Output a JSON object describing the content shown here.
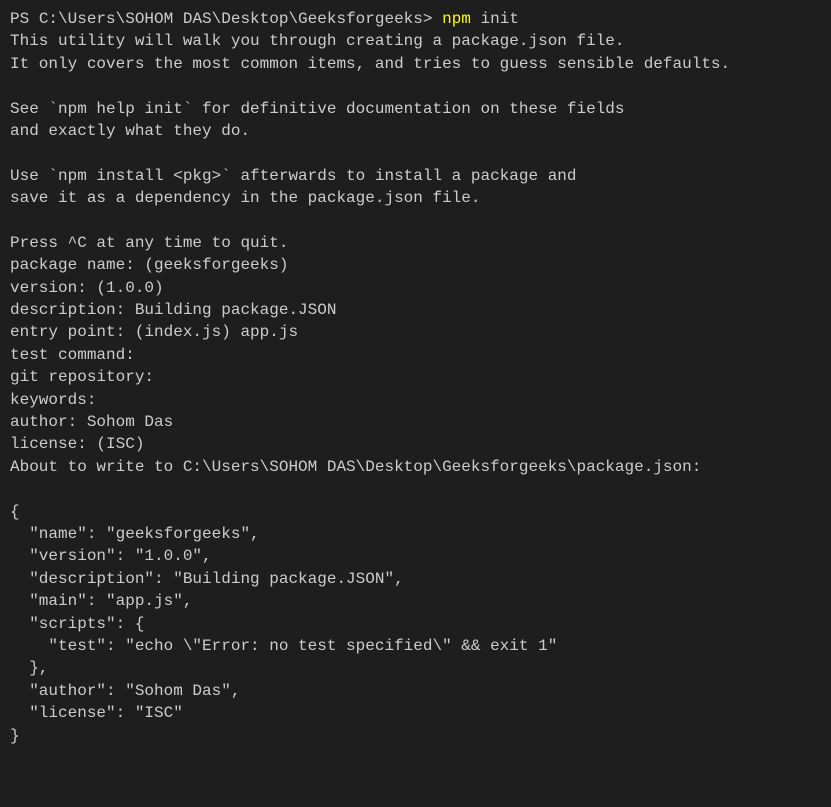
{
  "prompt": {
    "prefix": "PS ",
    "path": "C:\\Users\\SOHOM DAS\\Desktop\\Geeksforgeeks",
    "suffix": ">"
  },
  "command": {
    "name": "npm",
    "arg": "init"
  },
  "output": [
    "This utility will walk you through creating a package.json file.",
    "It only covers the most common items, and tries to guess sensible defaults.",
    "",
    "See `npm help init` for definitive documentation on these fields",
    "and exactly what they do.",
    "",
    "Use `npm install <pkg>` afterwards to install a package and",
    "save it as a dependency in the package.json file.",
    "",
    "Press ^C at any time to quit.",
    "package name: (geeksforgeeks)",
    "version: (1.0.0)",
    "description: Building package.JSON",
    "entry point: (index.js) app.js",
    "test command:",
    "git repository:",
    "keywords:",
    "author: Sohom Das",
    "license: (ISC)",
    "About to write to C:\\Users\\SOHOM DAS\\Desktop\\Geeksforgeeks\\package.json:",
    "",
    "{",
    "  \"name\": \"geeksforgeeks\",",
    "  \"version\": \"1.0.0\",",
    "  \"description\": \"Building package.JSON\",",
    "  \"main\": \"app.js\",",
    "  \"scripts\": {",
    "    \"test\": \"echo \\\"Error: no test specified\\\" && exit 1\"",
    "  },",
    "  \"author\": \"Sohom Das\",",
    "  \"license\": \"ISC\"",
    "}"
  ]
}
